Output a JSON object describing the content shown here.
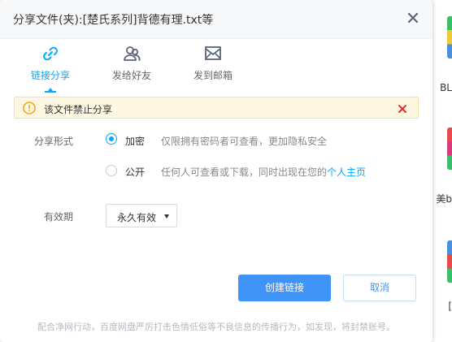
{
  "dialog": {
    "title": "分享文件(夹):[楚氏系列]背德有理.txt等"
  },
  "tabs": [
    {
      "label": "链接分享",
      "icon": "link-icon",
      "active": true
    },
    {
      "label": "发给好友",
      "icon": "friends-icon",
      "active": false
    },
    {
      "label": "发到邮箱",
      "icon": "mail-icon",
      "active": false
    }
  ],
  "warning": {
    "text": "该文件禁止分享"
  },
  "share_form": {
    "label": "分享形式",
    "options": [
      {
        "label": "加密",
        "desc": "仅限拥有密码者可查看，更加隐私安全",
        "checked": true
      },
      {
        "label": "公开",
        "desc": "任何人可查看或下载，同时出现在您的",
        "link": "个人主页",
        "checked": false
      }
    ]
  },
  "validity": {
    "label": "有效期",
    "value": "永久有效"
  },
  "buttons": {
    "create": "创建链接",
    "cancel": "取消"
  },
  "footer": "配合净网行动，百度网盘严厉打击色情低俗等不良信息的传播行为，如发现，将封禁账号。",
  "background": {
    "text1": "BL",
    "text2": "美b",
    "text3": "["
  },
  "colors": {
    "accent": "#06a7ff",
    "primary_button": "#4094f7",
    "warning_bg": "#fef7e1",
    "warning_icon": "#f5a623",
    "close_red": "#e0322a"
  }
}
